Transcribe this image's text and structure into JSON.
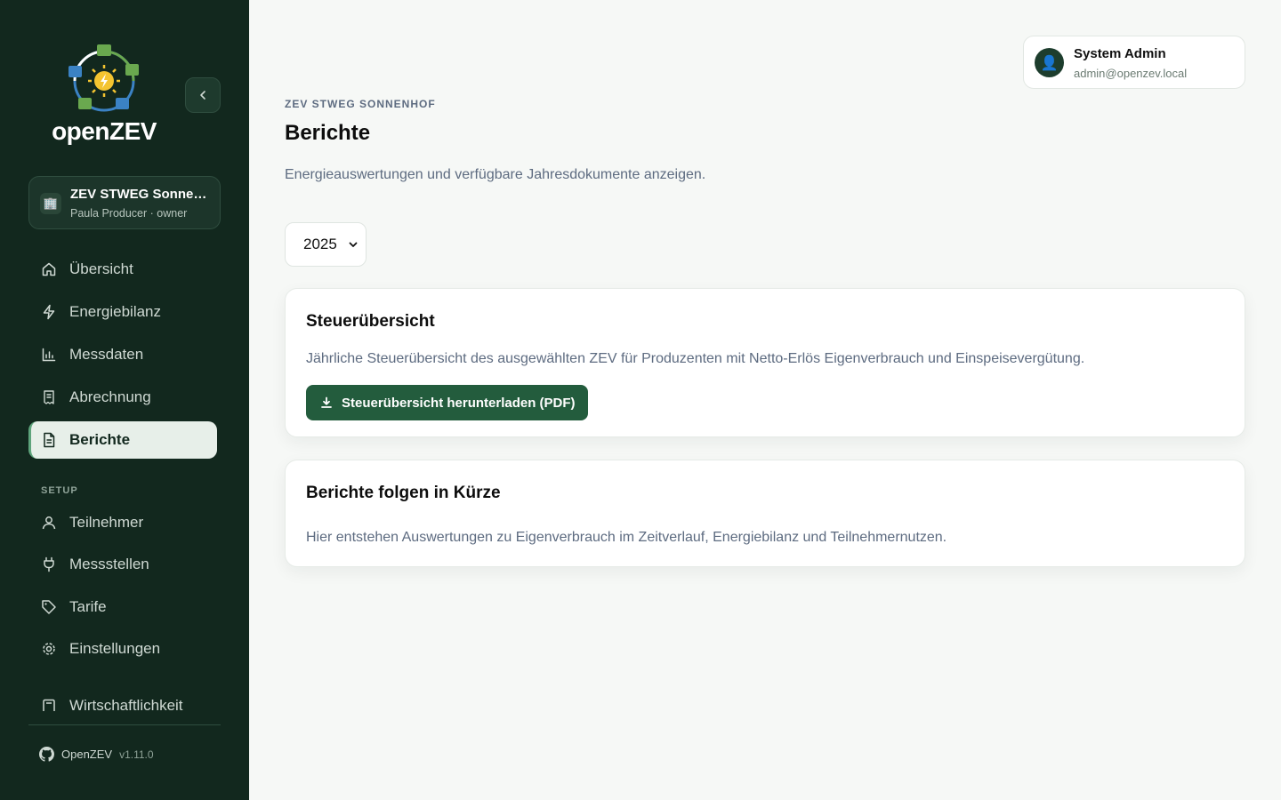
{
  "sidebar": {
    "brand": "openZEV",
    "org": {
      "name": "ZEV STWEG Sonnenhof",
      "subtitle": "Paula Producer · owner"
    },
    "items": [
      {
        "label": "Übersicht",
        "icon": "home-icon"
      },
      {
        "label": "Energiebilanz",
        "icon": "lightning-icon"
      },
      {
        "label": "Messdaten",
        "icon": "bar-chart-icon"
      },
      {
        "label": "Abrechnung",
        "icon": "receipt-icon"
      },
      {
        "label": "Berichte",
        "icon": "document-icon",
        "active": true
      }
    ],
    "setup_label": "SETUP",
    "setup_items": [
      {
        "label": "Teilnehmer",
        "icon": "user-icon"
      },
      {
        "label": "Messstellen",
        "icon": "plug-icon"
      },
      {
        "label": "Tarife",
        "icon": "tag-icon"
      },
      {
        "label": "Einstellungen",
        "icon": "gear-icon"
      },
      {
        "label": "Wirtschaftlichkeit",
        "icon": "calculator-icon"
      }
    ],
    "footer": {
      "app": "OpenZEV",
      "version": "v1.11.0"
    }
  },
  "user": {
    "name": "System Admin",
    "email": "admin@openzev.local"
  },
  "main": {
    "eyebrow": "ZEV STWEG SONNENHOF",
    "title": "Berichte",
    "description": "Energieauswertungen und verfügbare Jahresdokumente anzeigen.",
    "year": "2025",
    "cards": [
      {
        "title": "Steuerübersicht",
        "text": "Jährliche Steuerübersicht des ausgewählten ZEV für Produzenten mit Netto-Erlös Eigenverbrauch und Einspeisevergütung.",
        "button": "Steuerübersicht herunterladen (PDF)"
      },
      {
        "title": "Berichte folgen in Kürze",
        "text": "Hier entstehen Auswertungen zu Eigenverbrauch im Zeitverlauf, Energiebilanz und Teilnehmernutzen."
      }
    ]
  },
  "colors": {
    "sidebar_bg": "#12281e",
    "accent": "#235c3d",
    "page_bg": "#f6f8f6",
    "active_nav_bg": "#e7efe9"
  }
}
